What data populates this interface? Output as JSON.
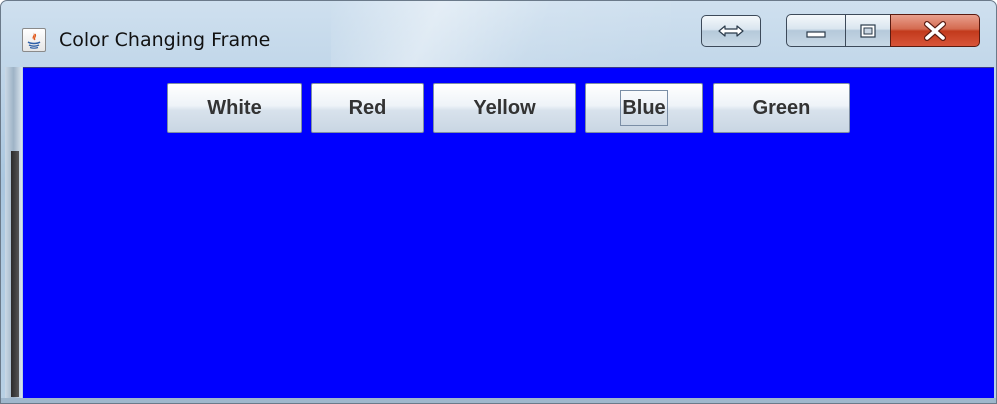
{
  "window": {
    "title": "Color Changing Frame",
    "icon": "java-icon",
    "controls": {
      "resize_icon": "double-arrow-icon",
      "minimize_icon": "minimize-icon",
      "maximize_icon": "maximize-icon",
      "close_icon": "close-icon"
    }
  },
  "panel": {
    "background_color": "#0000ff",
    "buttons": [
      {
        "label": "White"
      },
      {
        "label": "Red"
      },
      {
        "label": "Yellow"
      },
      {
        "label": "Blue",
        "focused": true
      },
      {
        "label": "Green"
      }
    ]
  }
}
